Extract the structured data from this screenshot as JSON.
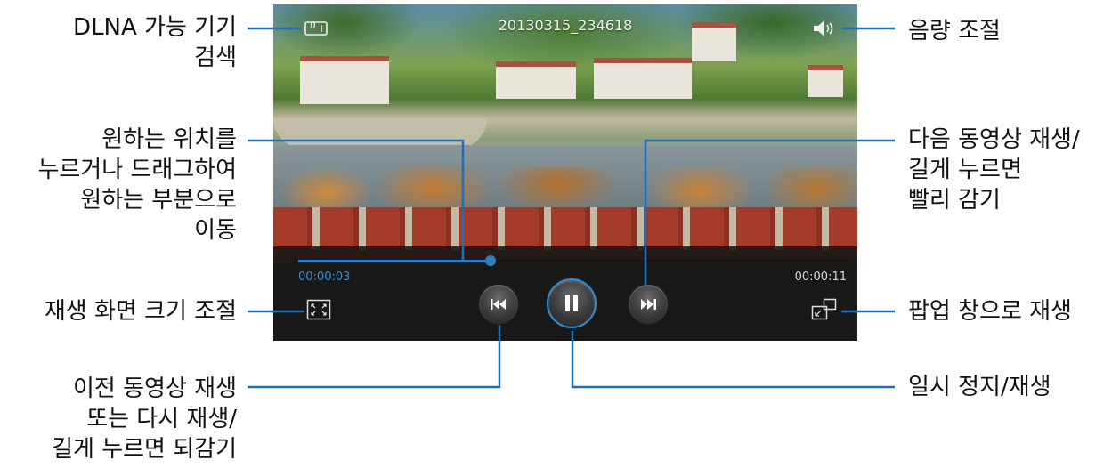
{
  "video": {
    "title": "20130315_234618",
    "elapsed": "00:00:03",
    "total": "00:00:11",
    "progress_fraction": 0.35
  },
  "icons": {
    "dlna": "dlna-icon",
    "volume": "volume-icon",
    "screen_size": "screen-size-icon",
    "popup": "popup-play-icon",
    "prev": "previous-icon",
    "play_pause": "pause-icon",
    "next": "next-icon"
  },
  "colors": {
    "accent": "#2d8fd8",
    "control_bar": "#161616",
    "callout_line": "#1f6fb8"
  },
  "callouts": {
    "dlna": "DLNA 가능 기기\n검색",
    "volume": "음량 조절",
    "seek": "원하는 위치를\n누르거나 드래그하여\n원하는 부분으로\n이동",
    "next": "다음 동영상 재생/\n길게 누르면\n빨리 감기",
    "screen_size": "재생 화면 크기 조절",
    "popup": "팝업 창으로 재생",
    "prev": "이전 동영상 재생\n또는 다시 재생/\n길게 누르면 되감기",
    "pause": "일시 정지/재생"
  }
}
